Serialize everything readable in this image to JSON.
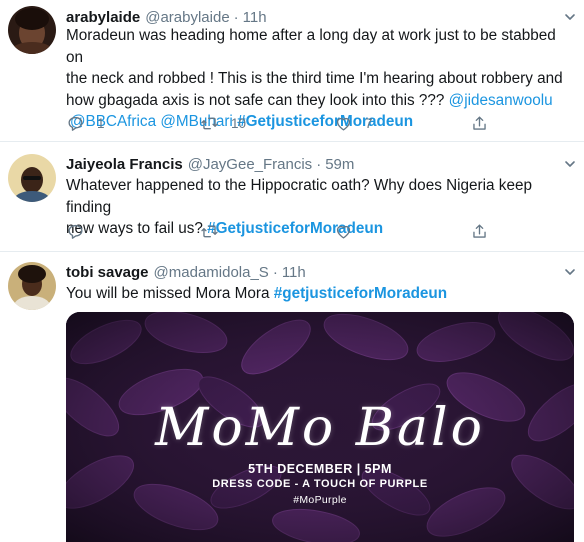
{
  "tweets": [
    {
      "display_name": "arabylaide",
      "handle": "@arabylaide",
      "separator": "·",
      "time": "11h",
      "lines": [
        "Moradeun was heading home after a long day at work just to be stabbed on",
        "the neck and robbed ! This  is the third time I'm hearing about robbery and",
        "how gbagada axis is not safe can they look into this ???"
      ],
      "mentions_line3": "@jidesanwoolu",
      "line4_mentions": [
        "@BBCAfrica",
        "@MBuhari"
      ],
      "hashtag": "#GetjusticeforMoradeun",
      "reply_count": "1",
      "retweet_count": "10",
      "like_count": "7"
    },
    {
      "display_name": "Jaiyeola Francis",
      "handle": "@JayGee_Francis",
      "separator": "·",
      "time": "59m",
      "lines": [
        "Whatever happened to the Hippocratic oath? Why does Nigeria keep finding",
        "new ways to fail us?"
      ],
      "hashtag": "#GetjusticeforMoradeun"
    },
    {
      "display_name": "tobi savage",
      "handle": "@madamidola_S",
      "separator": "·",
      "time": "11h",
      "text": "You will be missed Mora Mora",
      "hashtag": "#getjusticeforMoradeun",
      "media": {
        "title": "MoMo Balo",
        "date": "5TH DECEMBER | 5PM",
        "dress_code": "DRESS CODE - A TOUCH OF PURPLE",
        "hashtag": "#MoPurple"
      }
    }
  ],
  "icons": {
    "reply": "reply-icon",
    "retweet": "retweet-icon",
    "like": "heart-icon",
    "share": "share-icon",
    "caret": "chevron-down-icon"
  },
  "colors": {
    "link": "#1b95e0",
    "muted": "#657786",
    "text": "#14171a",
    "divider": "#e6ecf0",
    "flyer_purple": "#5b2a6e"
  }
}
